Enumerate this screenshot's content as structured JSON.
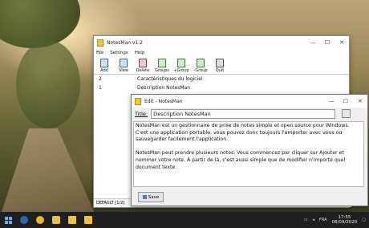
{
  "main_window": {
    "title": "NotesMan v1.2",
    "menu": [
      "File",
      "Settings",
      "Help"
    ],
    "toolbar": [
      "Add",
      "View",
      "Delete",
      "Groups",
      "+Group",
      "-Group",
      "Quit"
    ],
    "notes": [
      {
        "num": "2",
        "title": "Caractéristiques du logiciel"
      },
      {
        "num": "1",
        "title": "Description NotesMan"
      }
    ],
    "status": "DEFAULT [1/2]"
  },
  "edit_window": {
    "title": "Edit - NotesMan",
    "title_label": "Title:",
    "title_value": "Description NotesMan",
    "paragraphs": [
      "NotesMan est un gestionnaire de prise de notes simple et open source pour Windows. C'est une application portable, vous pouvez donc toujours l'emporter avec vous ou sauvegarder facilement l'application.",
      "NotesMan peut prendre plusieurs notes. Vous commencez par cliquer sur Ajouter et nommer votre note. À partir de là, c'est aussi simple que de modifier n'importe quel document texte."
    ],
    "save_label": "Save"
  },
  "taskbar": {
    "language": "FRA",
    "time": "17:55",
    "date": "08/09/2020"
  },
  "window_controls": {
    "minimize": "—",
    "maximize": "☐",
    "close": "✕"
  }
}
